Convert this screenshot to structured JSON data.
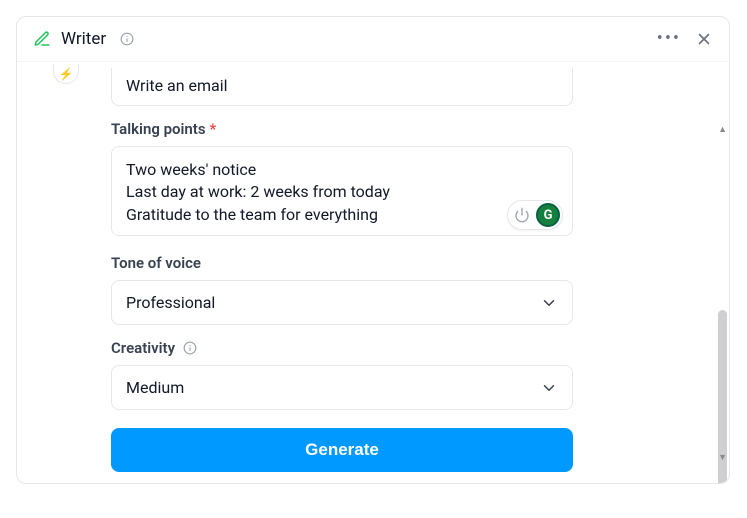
{
  "header": {
    "title": "Writer"
  },
  "form": {
    "writeType": "Write an email",
    "talkingPointsLabel": "Talking points",
    "talkingPointsValue": "Two weeks' notice\nLast day at work: 2 weeks from today\nGratitude to the team for everything",
    "toneLabel": "Tone of voice",
    "toneValue": "Professional",
    "creativityLabel": "Creativity",
    "creativityValue": "Medium",
    "generateLabel": "Generate"
  }
}
